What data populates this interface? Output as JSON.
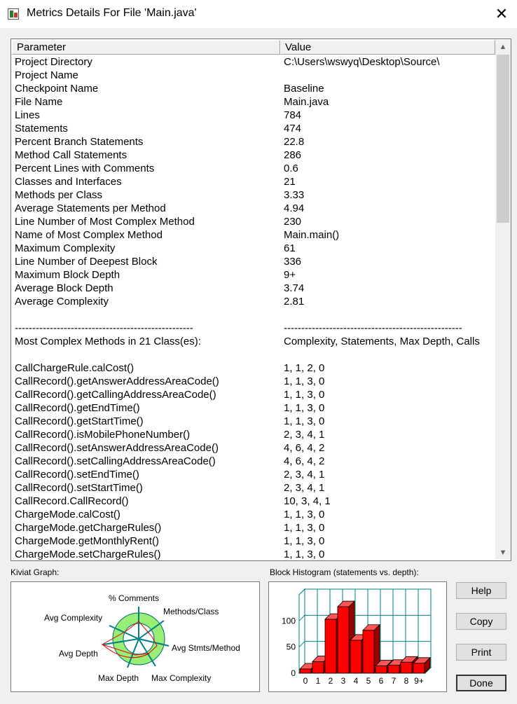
{
  "window": {
    "title": "Metrics Details For File 'Main.java'",
    "close_glyph": "✕"
  },
  "table": {
    "headers": [
      "Parameter",
      "Value"
    ],
    "rows": [
      [
        "Project Directory",
        "C:\\Users\\wswyq\\Desktop\\Source\\"
      ],
      [
        "Project Name",
        ""
      ],
      [
        "Checkpoint Name",
        "Baseline"
      ],
      [
        "File Name",
        "Main.java"
      ],
      [
        "Lines",
        "784"
      ],
      [
        "Statements",
        "474"
      ],
      [
        "Percent Branch Statements",
        "22.8"
      ],
      [
        "Method Call Statements",
        "286"
      ],
      [
        "Percent Lines with Comments",
        "0.6"
      ],
      [
        "Classes and Interfaces",
        "21"
      ],
      [
        "Methods per Class",
        "3.33"
      ],
      [
        "Average Statements per Method",
        "4.94"
      ],
      [
        "Line Number of Most Complex Method",
        "230"
      ],
      [
        "Name of Most Complex Method",
        "Main.main()"
      ],
      [
        "Maximum Complexity",
        "61"
      ],
      [
        "Line Number of Deepest Block",
        "336"
      ],
      [
        "Maximum Block Depth",
        "9+"
      ],
      [
        "Average Block Depth",
        "3.74"
      ],
      [
        "Average Complexity",
        "2.81"
      ],
      [
        "",
        ""
      ],
      [
        "---------------------------------------------------",
        "---------------------------------------------------"
      ],
      [
        "Most Complex Methods in 21 Class(es):",
        "Complexity, Statements, Max Depth, Calls"
      ],
      [
        "",
        ""
      ],
      [
        "CallChargeRule.calCost()",
        "1, 1, 2, 0"
      ],
      [
        "CallRecord().getAnswerAddressAreaCode()",
        "1, 1, 3, 0"
      ],
      [
        "CallRecord().getCallingAddressAreaCode()",
        "1, 1, 3, 0"
      ],
      [
        "CallRecord().getEndTime()",
        "1, 1, 3, 0"
      ],
      [
        "CallRecord().getStartTime()",
        "1, 1, 3, 0"
      ],
      [
        "CallRecord().isMobilePhoneNumber()",
        "2, 3, 4, 1"
      ],
      [
        "CallRecord().setAnswerAddressAreaCode()",
        "4, 6, 4, 2"
      ],
      [
        "CallRecord().setCallingAddressAreaCode()",
        "4, 6, 4, 2"
      ],
      [
        "CallRecord().setEndTime()",
        "2, 3, 4, 1"
      ],
      [
        "CallRecord().setStartTime()",
        "2, 3, 4, 1"
      ],
      [
        "CallRecord.CallRecord()",
        "10, 3, 4, 1"
      ],
      [
        "ChargeMode.calCost()",
        "1, 1, 3, 0"
      ],
      [
        "ChargeMode.getChargeRules()",
        "1, 1, 3, 0"
      ],
      [
        "ChargeMode.getMonthlyRent()",
        "1, 1, 3, 0"
      ],
      [
        "ChargeMode.setChargeRules()",
        "1, 1, 3, 0"
      ]
    ],
    "scroll_up_glyph": "▲",
    "scroll_down_glyph": "▼"
  },
  "kiviat": {
    "label": "Kiviat Graph:",
    "axes": [
      "% Comments",
      "Methods/Class",
      "Avg Stmts/Method",
      "Max Complexity",
      "Max Depth",
      "Avg Depth",
      "Avg Complexity"
    ],
    "colors": {
      "ring": "#99ee77",
      "axis": "#008080",
      "plot": "#dd0000"
    }
  },
  "histogram": {
    "label": "Block Histogram (statements vs. depth):",
    "chart_data": {
      "type": "bar",
      "categories": [
        "0",
        "1",
        "2",
        "3",
        "4",
        "5",
        "6",
        "7",
        "8",
        "9+"
      ],
      "values": [
        8,
        22,
        103,
        127,
        63,
        82,
        14,
        15,
        21,
        19
      ],
      "yticks": [
        "0",
        "50",
        "100"
      ],
      "ylim": [
        0,
        150
      ],
      "grid": true,
      "bar_color": "#ff0000"
    }
  },
  "buttons": {
    "help": "Help",
    "copy": "Copy",
    "print": "Print",
    "done": "Done"
  }
}
